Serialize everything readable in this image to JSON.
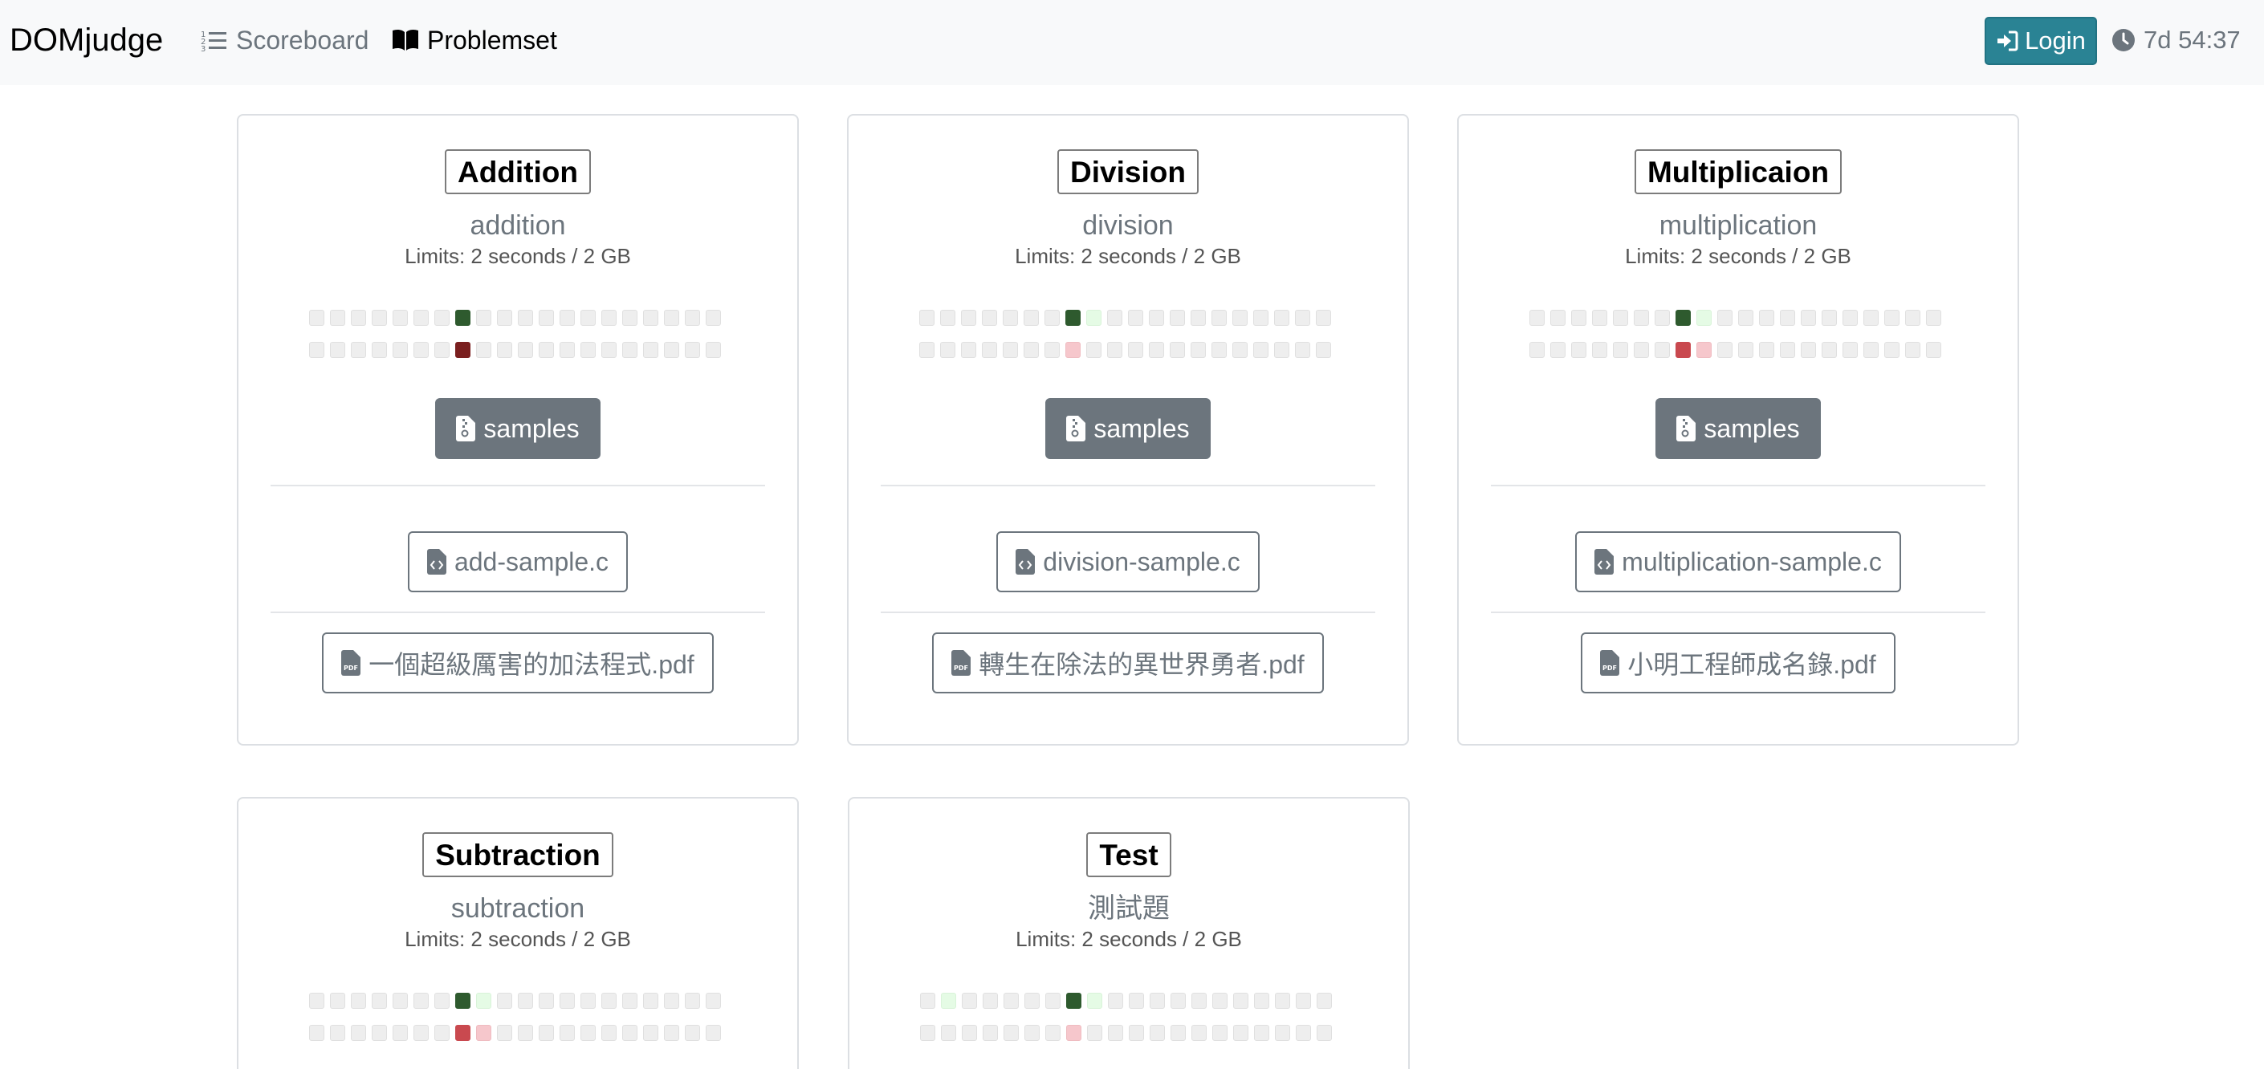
{
  "nav": {
    "brand": "DOMjudge",
    "scoreboard": "Scoreboard",
    "problemset": "Problemset",
    "login": "Login",
    "clock": "7d 54:37"
  },
  "problems": [
    {
      "name": "Addition",
      "shortname": "addition",
      "limits": "Limits: 2 seconds / 2 GB",
      "samples": "samples",
      "source_file": "add-sample.c",
      "pdf_file": "一個超級厲害的加法程式.pdf",
      "row1": [
        "e",
        "e",
        "e",
        "e",
        "e",
        "e",
        "e",
        "g1",
        "e",
        "e",
        "e",
        "e",
        "e",
        "e",
        "e",
        "e",
        "e",
        "e",
        "e",
        "e"
      ],
      "row2": [
        "e",
        "e",
        "e",
        "e",
        "e",
        "e",
        "e",
        "r1",
        "e",
        "e",
        "e",
        "e",
        "e",
        "e",
        "e",
        "e",
        "e",
        "e",
        "e",
        "e"
      ]
    },
    {
      "name": "Division",
      "shortname": "division",
      "limits": "Limits: 2 seconds / 2 GB",
      "samples": "samples",
      "source_file": "division-sample.c",
      "pdf_file": "轉生在除法的異世界勇者.pdf",
      "row1": [
        "e",
        "e",
        "e",
        "e",
        "e",
        "e",
        "e",
        "g1",
        "g2",
        "e",
        "e",
        "e",
        "e",
        "e",
        "e",
        "e",
        "e",
        "e",
        "e",
        "e"
      ],
      "row2": [
        "e",
        "e",
        "e",
        "e",
        "e",
        "e",
        "e",
        "r3",
        "e",
        "e",
        "e",
        "e",
        "e",
        "e",
        "e",
        "e",
        "e",
        "e",
        "e",
        "e"
      ]
    },
    {
      "name": "Multiplicaion",
      "shortname": "multiplication",
      "limits": "Limits: 2 seconds / 2 GB",
      "samples": "samples",
      "source_file": "multiplication-sample.c",
      "pdf_file": "小明工程師成名錄.pdf",
      "row1": [
        "e",
        "e",
        "e",
        "e",
        "e",
        "e",
        "e",
        "g1",
        "g2",
        "e",
        "e",
        "e",
        "e",
        "e",
        "e",
        "e",
        "e",
        "e",
        "e",
        "e"
      ],
      "row2": [
        "e",
        "e",
        "e",
        "e",
        "e",
        "e",
        "e",
        "r2",
        "r3",
        "e",
        "e",
        "e",
        "e",
        "e",
        "e",
        "e",
        "e",
        "e",
        "e",
        "e"
      ]
    },
    {
      "name": "Subtraction",
      "shortname": "subtraction",
      "limits": "Limits: 2 seconds / 2 GB",
      "row1": [
        "e",
        "e",
        "e",
        "e",
        "e",
        "e",
        "e",
        "g1",
        "g2",
        "e",
        "e",
        "e",
        "e",
        "e",
        "e",
        "e",
        "e",
        "e",
        "e",
        "e"
      ],
      "row2": [
        "e",
        "e",
        "e",
        "e",
        "e",
        "e",
        "e",
        "r2",
        "r3",
        "e",
        "e",
        "e",
        "e",
        "e",
        "e",
        "e",
        "e",
        "e",
        "e",
        "e"
      ]
    },
    {
      "name": "Test",
      "shortname": "測試題",
      "limits": "Limits: 2 seconds / 2 GB",
      "row1": [
        "e",
        "g2",
        "e",
        "e",
        "e",
        "e",
        "e",
        "g1",
        "g2",
        "e",
        "e",
        "e",
        "e",
        "e",
        "e",
        "e",
        "e",
        "e",
        "e",
        "e"
      ],
      "row2": [
        "e",
        "e",
        "e",
        "e",
        "e",
        "e",
        "e",
        "r3",
        "e",
        "e",
        "e",
        "e",
        "e",
        "e",
        "e",
        "e",
        "e",
        "e",
        "e",
        "e"
      ]
    }
  ]
}
